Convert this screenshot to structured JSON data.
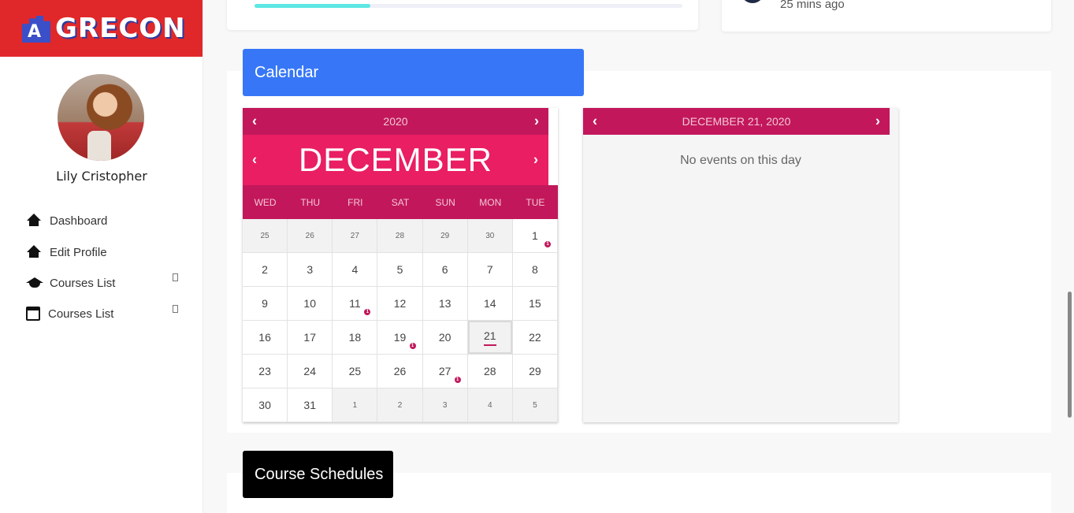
{
  "brand": {
    "name": "GRECON",
    "logo_glyph": "A",
    "color": "#e0282a"
  },
  "user": {
    "name": "Lily Cristopher"
  },
  "nav": [
    {
      "label": "Dashboard",
      "icon": "home-icon"
    },
    {
      "label": "Edit Profile",
      "icon": "home-icon"
    },
    {
      "label": "Courses List",
      "icon": "graduation-cap-icon",
      "chevron": ""
    },
    {
      "label": "Courses List",
      "icon": "calendar-icon",
      "chevron": ""
    }
  ],
  "top_cards": {
    "progress_fraction": 0.27,
    "activity_time": "25 mins ago"
  },
  "calendar_section": {
    "title": "Calendar"
  },
  "calendar": {
    "year": "2020",
    "month": "DECEMBER",
    "prev_arrow": "‹",
    "next_arrow": "›",
    "weekdays": [
      "WED",
      "THU",
      "FRI",
      "SAT",
      "SUN",
      "MON",
      "TUE"
    ],
    "weeks": [
      [
        {
          "d": "25",
          "other": true
        },
        {
          "d": "26",
          "other": true
        },
        {
          "d": "27",
          "other": true
        },
        {
          "d": "28",
          "other": true
        },
        {
          "d": "29",
          "other": true
        },
        {
          "d": "30",
          "other": true
        },
        {
          "d": "1",
          "event": "1"
        }
      ],
      [
        {
          "d": "2"
        },
        {
          "d": "3"
        },
        {
          "d": "4"
        },
        {
          "d": "5"
        },
        {
          "d": "6"
        },
        {
          "d": "7"
        },
        {
          "d": "8"
        }
      ],
      [
        {
          "d": "9"
        },
        {
          "d": "10"
        },
        {
          "d": "11",
          "event": "1"
        },
        {
          "d": "12"
        },
        {
          "d": "13"
        },
        {
          "d": "14"
        },
        {
          "d": "15"
        }
      ],
      [
        {
          "d": "16"
        },
        {
          "d": "17"
        },
        {
          "d": "18"
        },
        {
          "d": "19",
          "event": "1"
        },
        {
          "d": "20"
        },
        {
          "d": "21",
          "today": true
        },
        {
          "d": "22"
        }
      ],
      [
        {
          "d": "23"
        },
        {
          "d": "24"
        },
        {
          "d": "25"
        },
        {
          "d": "26"
        },
        {
          "d": "27",
          "event": "1"
        },
        {
          "d": "28"
        },
        {
          "d": "29"
        }
      ],
      [
        {
          "d": "30"
        },
        {
          "d": "31"
        },
        {
          "d": "1",
          "other": true
        },
        {
          "d": "2",
          "other": true
        },
        {
          "d": "3",
          "other": true
        },
        {
          "d": "4",
          "other": true
        },
        {
          "d": "5",
          "other": true
        }
      ]
    ],
    "accent_dark": "#c2185b",
    "accent": "#e91e63"
  },
  "events_panel": {
    "date": "DECEMBER 21, 2020",
    "empty_text": "No events on this day"
  },
  "schedules_section": {
    "title": "Course Schedules"
  }
}
